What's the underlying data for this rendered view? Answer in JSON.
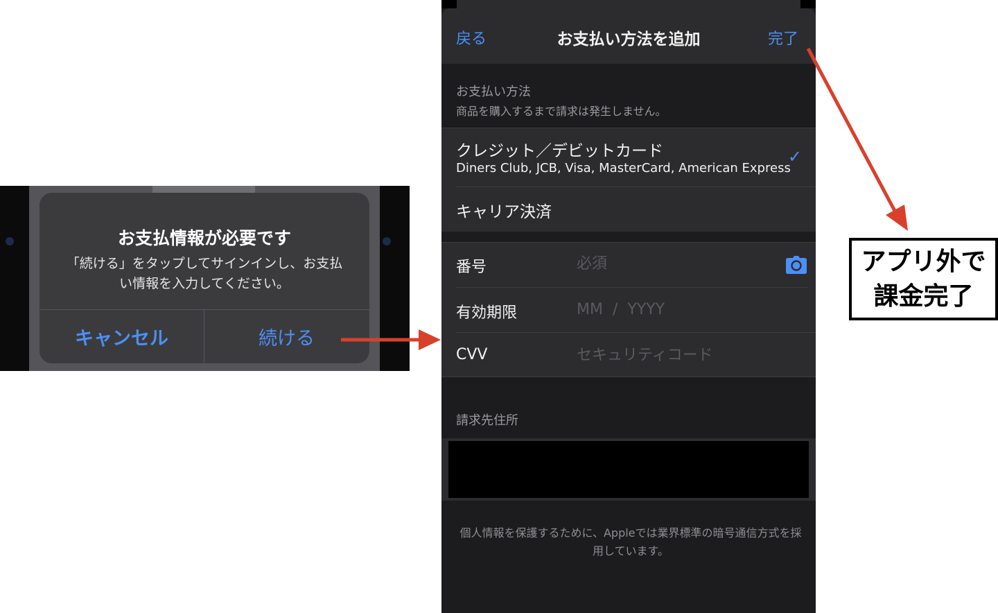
{
  "dialog": {
    "title": "お支払情報が必要です",
    "message": "「続ける」をタップしてサインインし、お支払い情報を入力してください。",
    "cancel_label": "キャンセル",
    "continue_label": "続ける"
  },
  "payment_screen": {
    "nav": {
      "back_label": "戻る",
      "title": "お支払い方法を追加",
      "done_label": "完了"
    },
    "method_section": {
      "header": "お支払い方法",
      "subheader": "商品を購入するまで請求は発生しません。"
    },
    "methods": [
      {
        "label": "クレジット／デビットカード",
        "sublabel": "Diners Club, JCB, Visa, MasterCard, American Express",
        "selected": true
      },
      {
        "label": "キャリア決済",
        "selected": false
      }
    ],
    "card_fields": {
      "number_label": "番号",
      "number_placeholder": "必須",
      "expiry_label": "有効期限",
      "expiry_placeholder": "MM  /  YYYY",
      "cvv_label": "CVV",
      "cvv_placeholder": "セキュリティコード"
    },
    "billing_header": "請求先住所",
    "footer_note": "個人情報を保護するために、Appleでは業界標準の暗号通信方式を採用しています。"
  },
  "annotation": {
    "callout_line1": "アプリ外で",
    "callout_line2": "課金完了",
    "arrow_color": "#d9402b"
  },
  "colors": {
    "accent": "#4c8ff6",
    "screen_bg": "#1c1c1e",
    "cell_bg": "#2c2c2e",
    "dialog_bg": "#3b3b3e"
  },
  "icons": {
    "selected": "checkmark-icon",
    "scan_card": "camera-icon"
  }
}
